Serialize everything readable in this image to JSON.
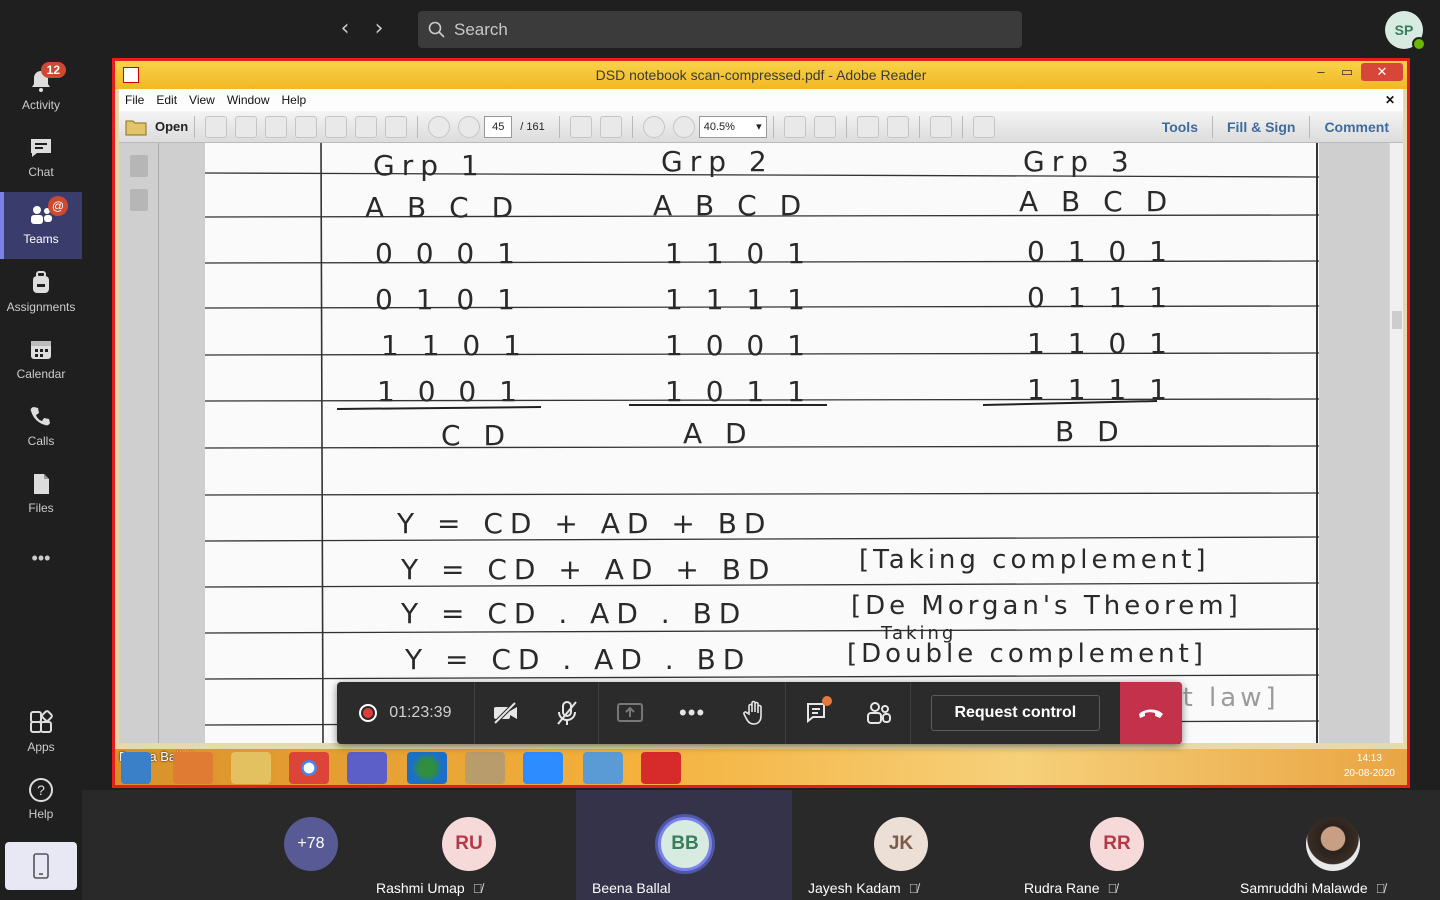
{
  "topbar": {
    "search_placeholder": "Search",
    "user_initials": "SP"
  },
  "rail": {
    "items": [
      {
        "label": "Activity",
        "badge": "12"
      },
      {
        "label": "Chat"
      },
      {
        "label": "Teams",
        "badge": "@"
      },
      {
        "label": "Assignments"
      },
      {
        "label": "Calendar"
      },
      {
        "label": "Calls"
      },
      {
        "label": "Files"
      },
      {
        "label": "Apps"
      },
      {
        "label": "Help"
      }
    ],
    "more_label": "•••"
  },
  "reader": {
    "title": "DSD notebook scan-compressed.pdf - Adobe Reader",
    "menu": [
      "File",
      "Edit",
      "View",
      "Window",
      "Help"
    ],
    "open_label": "Open",
    "page_current": "45",
    "page_total": "/ 161",
    "zoom": "40.5%",
    "tools": "Tools",
    "fill_sign": "Fill & Sign",
    "comment": "Comment"
  },
  "notes": {
    "groups": [
      "Grp 1",
      "Grp 2",
      "Grp 3"
    ],
    "header": [
      "A B C D",
      "A B C D",
      "A B C D"
    ],
    "rows": [
      [
        "0 0 0 1",
        "1 1 0 1",
        "0 1 0 1"
      ],
      [
        "0 1 0 1",
        "1 1 1 1",
        "0 1 1 1"
      ],
      [
        "1 1 0 1",
        "1 0 0 1",
        "1 1 0 1"
      ],
      [
        "1 0 0 1",
        "1 0 1 1",
        "1 1 1 1"
      ]
    ],
    "results": [
      "C D",
      "A D",
      "B D"
    ],
    "eq": [
      "Y = CD + AD + BD",
      "Y = CD + AD + BD",
      "Y = CD . AD . BD",
      "Y = CD . AD . BD"
    ],
    "notes_right": [
      "[Taking complement]",
      "[De Morgan's Theorem]",
      "Taking",
      "[Double complement]",
      "[Double complement law]"
    ]
  },
  "taskbar": {
    "owner": "Beena Ballal",
    "time": "14:13",
    "date": "20-08-2020"
  },
  "meeting": {
    "timer": "01:23:39",
    "request_control": "Request control"
  },
  "participants": {
    "overflow": "+78",
    "people": [
      {
        "initials": "RU",
        "name": "Rashmi Umap"
      },
      {
        "initials": "BB",
        "name": "Beena Ballal"
      },
      {
        "initials": "JK",
        "name": "Jayesh Kadam"
      },
      {
        "initials": "RR",
        "name": "Rudra Rane"
      },
      {
        "initials": "",
        "name": "Samruddhi Malawde"
      }
    ]
  },
  "colors": {
    "accent": "#7b83eb",
    "share_border": "#e81c1c",
    "hangup": "#c4314b"
  }
}
